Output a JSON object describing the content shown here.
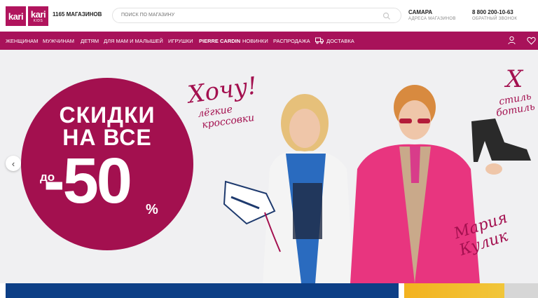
{
  "header": {
    "logo": {
      "main": "kari",
      "kids_main": "kari",
      "kids_sub": "KIDS"
    },
    "stores_label": "1165 МАГАЗИНОВ",
    "search": {
      "placeholder": "ПОИСК ПО МАГАЗИНУ",
      "icon": "search-icon"
    },
    "city": {
      "name": "САМАРА",
      "sub": "АДРЕСА МАГАЗИНОВ"
    },
    "phone": {
      "number": "8 800 200-10-63",
      "sub": "ОБРАТНЫЙ ЗВОНОК"
    }
  },
  "nav": {
    "items": [
      "ЖЕНЩИНАМ",
      "МУЖЧИНАМ",
      "ДЕТЯМ",
      "ДЛЯ МАМ И МАЛЫШЕЙ",
      "ИГРУШКИ",
      "PIERRE CARDIN",
      "НОВИНКИ",
      "РАСПРОДАЖА",
      "ДОСТАВКА"
    ],
    "icons": [
      "truck-icon",
      "user-icon",
      "heart-icon"
    ]
  },
  "hero": {
    "line1": "СКИДКИ",
    "line2": "НА ВСЕ",
    "prefix": "до",
    "amount": "-50",
    "percent": "%",
    "handwritten_left": {
      "a": "Хочу!",
      "b": "лёгкие",
      "c": "кроссовки"
    },
    "handwritten_right": {
      "a": "Х",
      "b": "стиль",
      "c": "ботиль"
    },
    "signature": "Мария Кулик",
    "arrow": "‹",
    "accent_color": "#a3104f"
  }
}
